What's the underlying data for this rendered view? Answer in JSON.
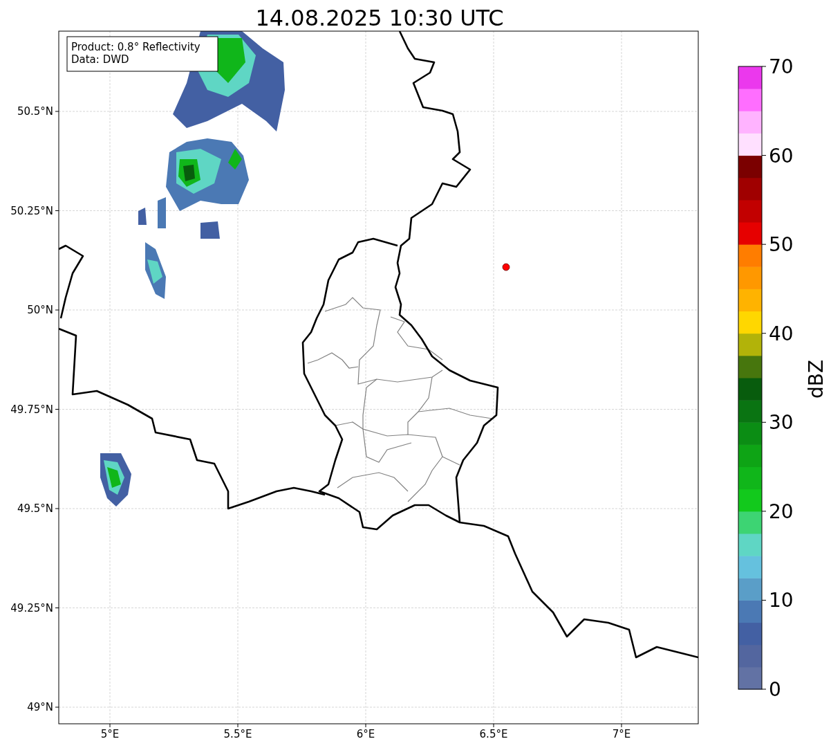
{
  "title": "14.08.2025 10:30 UTC",
  "info_box": {
    "lines": [
      "Product: 0.8° Reflectivity",
      "Data: DWD"
    ]
  },
  "map": {
    "xticks": [
      "5°E",
      "5.5°E",
      "6°E",
      "6.5°E",
      "7°E"
    ],
    "yticks": [
      "50.5°N",
      "50.25°N",
      "50°N",
      "49.75°N",
      "49.5°N",
      "49.25°N",
      "49°N"
    ]
  },
  "colorbar": {
    "label": "dBZ",
    "ticks": [
      "70",
      "60",
      "50",
      "40",
      "30",
      "20",
      "10",
      "0"
    ],
    "bins": [
      {
        "color": "#6272a4"
      },
      {
        "color": "#53669f"
      },
      {
        "color": "#4360a3"
      },
      {
        "color": "#4b79b4"
      },
      {
        "color": "#5a9ec8"
      },
      {
        "color": "#65c1de"
      },
      {
        "color": "#5fd6c4"
      },
      {
        "color": "#3dd473"
      },
      {
        "color": "#12c91c"
      },
      {
        "color": "#10b61a"
      },
      {
        "color": "#0ea415"
      },
      {
        "color": "#0b8d14"
      },
      {
        "color": "#0a7412"
      },
      {
        "color": "#085c0d"
      },
      {
        "color": "#47760d"
      },
      {
        "color": "#b2b309"
      },
      {
        "color": "#ffd700"
      },
      {
        "color": "#ffb300"
      },
      {
        "color": "#ff9800"
      },
      {
        "color": "#ff7d00"
      },
      {
        "color": "#e60000"
      },
      {
        "color": "#c20000"
      },
      {
        "color": "#a00000"
      },
      {
        "color": "#7b0000"
      },
      {
        "color": "#ffe0ff"
      },
      {
        "color": "#ffb3ff"
      },
      {
        "color": "#ff6eff"
      },
      {
        "color": "#eb38ed"
      }
    ]
  }
}
